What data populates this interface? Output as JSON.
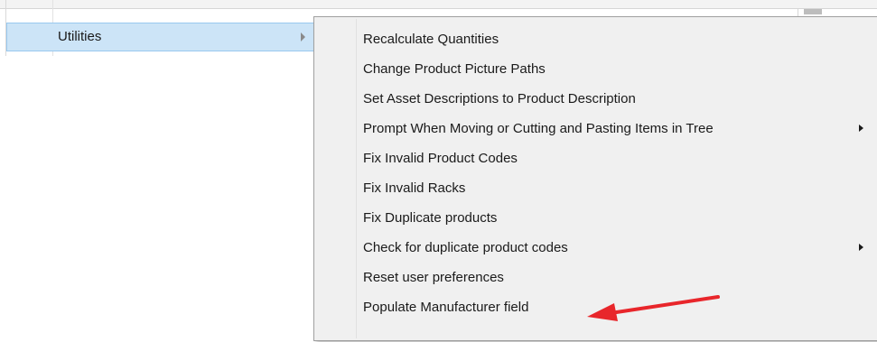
{
  "parent_menu": {
    "items": [
      {
        "label": "Utilities",
        "has_submenu": true,
        "highlighted": true
      }
    ]
  },
  "submenu": {
    "items": [
      {
        "label": "Recalculate Quantities",
        "has_submenu": false
      },
      {
        "label": "Change Product Picture Paths",
        "has_submenu": false
      },
      {
        "label": "Set Asset Descriptions to Product Description",
        "has_submenu": false
      },
      {
        "label": "Prompt When Moving or Cutting and Pasting Items in Tree",
        "has_submenu": true
      },
      {
        "label": "Fix Invalid Product Codes",
        "has_submenu": false
      },
      {
        "label": "Fix Invalid Racks",
        "has_submenu": false
      },
      {
        "label": "Fix Duplicate products",
        "has_submenu": false
      },
      {
        "label": "Check for duplicate product codes",
        "has_submenu": true
      },
      {
        "label": "Reset user preferences",
        "has_submenu": false
      },
      {
        "label": "Populate Manufacturer field",
        "has_submenu": false
      }
    ]
  },
  "colors": {
    "highlight": "#cce4f7",
    "submenu_bg": "#f0f0f0",
    "annotation_arrow": "#e8262b"
  },
  "annotation": {
    "icon": "red-arrow-icon",
    "points_to": "Populate Manufacturer field"
  }
}
